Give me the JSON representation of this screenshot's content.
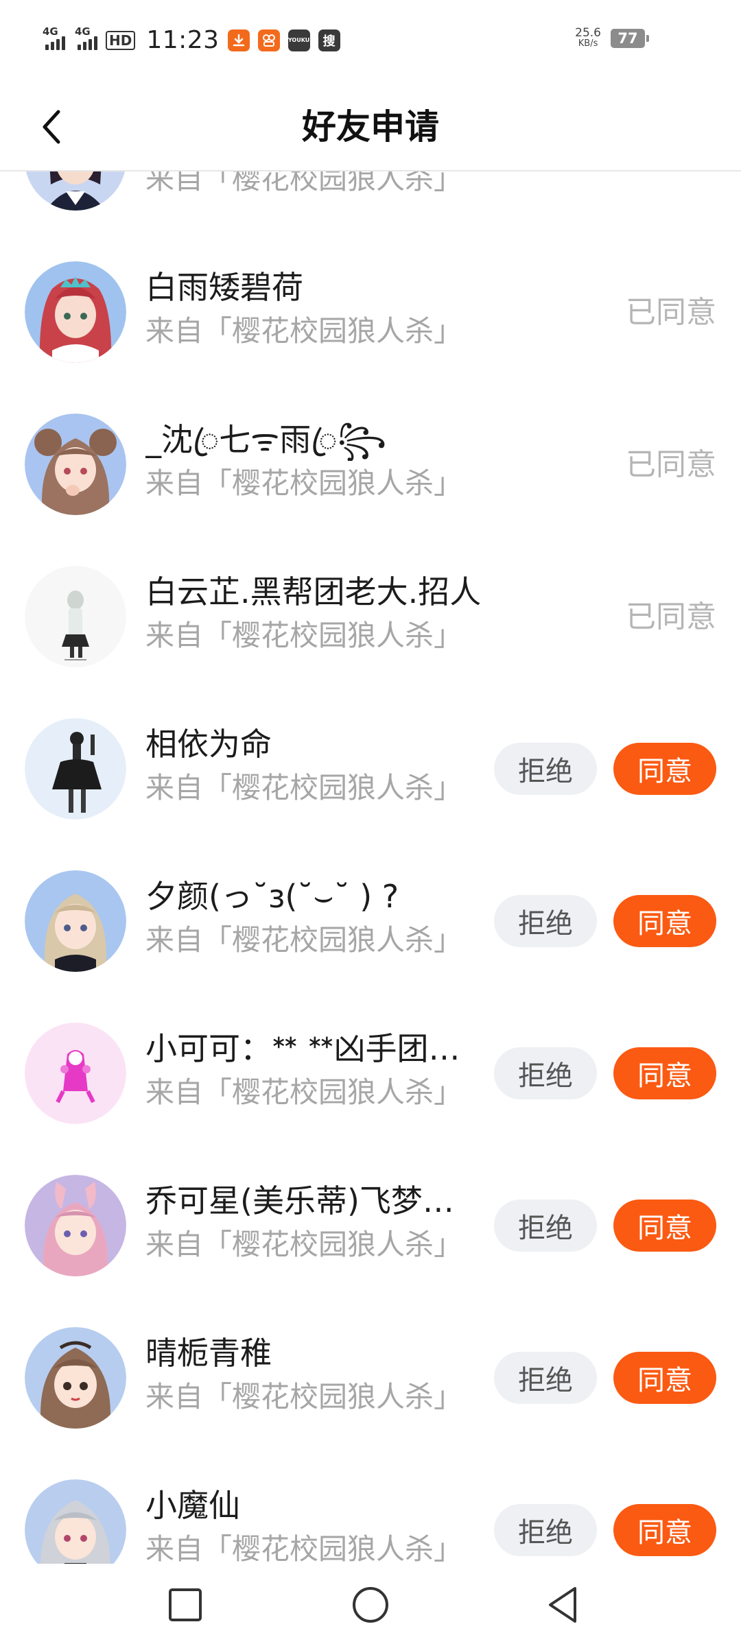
{
  "status_bar": {
    "signal1_label": "4G",
    "signal2_label": "4G",
    "hd_label": "HD",
    "time": "11:23",
    "net_speed_value": "25.6",
    "net_speed_unit": "KB/s",
    "battery_level": "77",
    "notification_icons": [
      "download-icon",
      "kuaishou-icon",
      "youku-icon",
      "sogou-search-icon"
    ]
  },
  "header": {
    "title": "好友申请"
  },
  "colors": {
    "accent": "#fb5a12",
    "muted_text": "#a6a6a6",
    "reject_bg": "#eef0f4"
  },
  "requests": [
    {
      "name": "",
      "source": "来自「樱花校园狼人杀」",
      "status": ""
    },
    {
      "name": "白雨矮碧荷",
      "source": "来自「樱花校园狼人杀」",
      "status": "已同意"
    },
    {
      "name": "_沈ꦿ七ᯤ雨ꦿ꧂",
      "source": "来自「樱花校园狼人杀」",
      "status": "已同意"
    },
    {
      "name": "白云芷.黑帮团老大.招人",
      "source": "来自「樱花校园狼人杀」",
      "status": "已同意"
    },
    {
      "name": "相依为命",
      "source": "来自「樱花校园狼人杀」",
      "reject": "拒绝",
      "accept": "同意"
    },
    {
      "name": "夕颜(っ˘з(˘⌣˘ ) ?",
      "source": "来自「樱花校园狼人杀」",
      "reject": "拒绝",
      "accept": "同意"
    },
    {
      "name": "小可可：ᕯ ᕯ凶手团…",
      "source": "来自「樱花校园狼人杀」",
      "reject": "拒绝",
      "accept": "同意"
    },
    {
      "name": "乔可星(美乐蒂)飞梦…",
      "source": "来自「樱花校园狼人杀」",
      "reject": "拒绝",
      "accept": "同意"
    },
    {
      "name": "晴栀青稚",
      "source": "来自「樱花校园狼人杀」",
      "reject": "拒绝",
      "accept": "同意"
    },
    {
      "name": "小魔仙",
      "source": "来自「樱花校园狼人杀」",
      "reject": "拒绝",
      "accept": "同意"
    }
  ],
  "nav_bar": {
    "icons": [
      "recents-square-icon",
      "home-circle-icon",
      "back-triangle-icon"
    ]
  }
}
